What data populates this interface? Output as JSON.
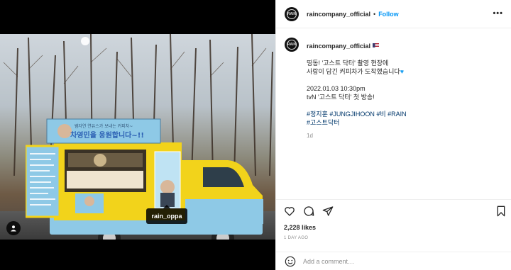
{
  "post": {
    "username": "raincompany_official",
    "follow_label": "Follow",
    "more_label": "•••",
    "avatar_text": "RAIN",
    "photo_tag": "rain_oppa",
    "caption": {
      "lines": [
        "띵동! '고스트 닥터' 촬영 현장에",
        "사랑이 담긴 커피차가 도착했습니다"
      ],
      "date_line": "2022.01.03 10:30pm",
      "program_line": "tvN '고스트 닥터' 첫 방송!",
      "hashtags_line1": "#정지훈 #JUNGJIHOON #비 #RAIN",
      "hashtags_line2": "#고스트닥터",
      "age": "1d"
    },
    "likes": "2,228 likes",
    "posted_ago": "1 DAY AGO",
    "comment_placeholder": "Add a comment…"
  },
  "truck": {
    "banner_line1": "쌤자연 연유스가 보내는 커피차~",
    "banner_line2": "차영민을 응원합니다~!!",
    "side_poster_text": "배우 정지훈 씨가 보내는 사랑이 가득한 커피차입니다"
  },
  "colors": {
    "accent": "#0095f6",
    "truck_yellow": "#f2d31b",
    "truck_blue": "#8ec9e6",
    "hashtag": "#00376b"
  },
  "icons": {
    "like": "heart-icon",
    "comment": "comment-icon",
    "share": "share-icon",
    "save": "bookmark-icon",
    "emoji": "emoji-icon",
    "user_tag": "user-tag-icon"
  }
}
